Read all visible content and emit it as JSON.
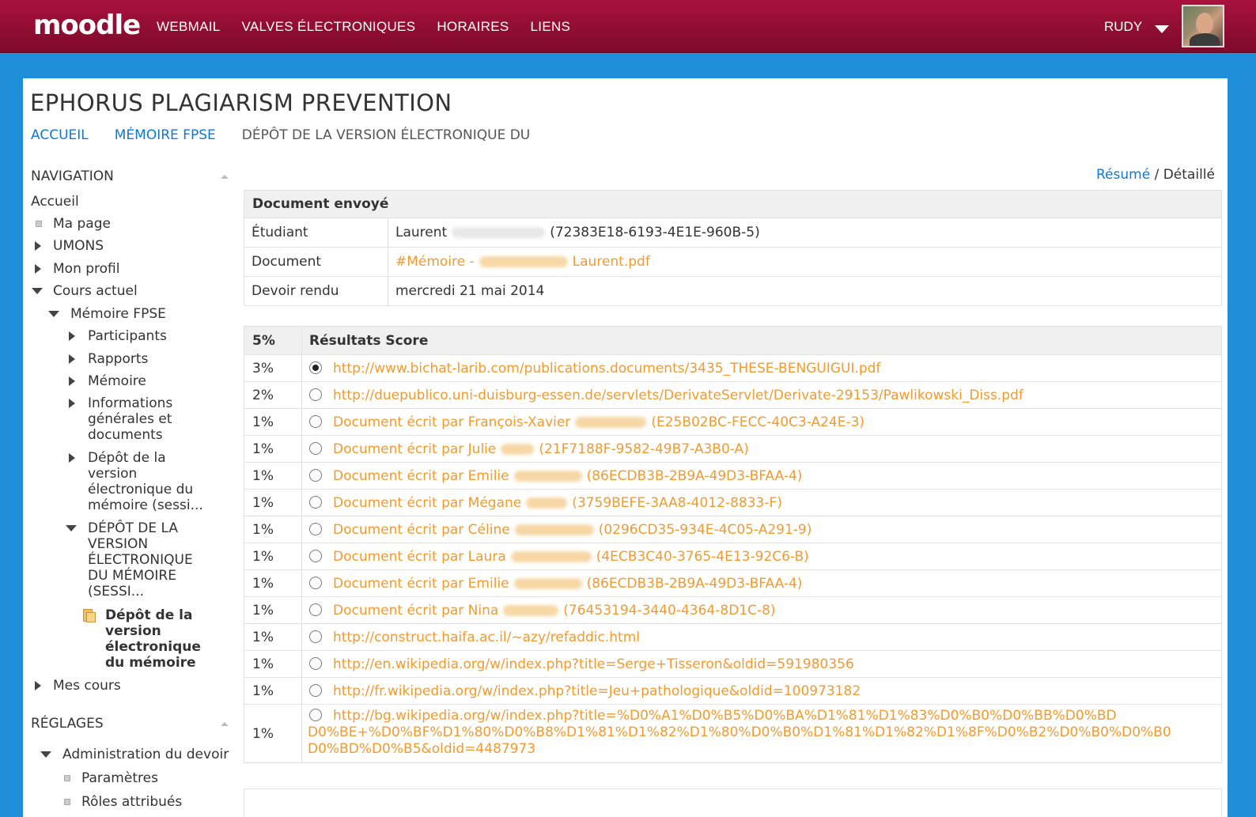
{
  "header": {
    "logo": "moodle",
    "nav": [
      "WEBMAIL",
      "VALVES ÉLECTRONIQUES",
      "HORAIRES",
      "LIENS"
    ],
    "user": "RUDY"
  },
  "page": {
    "title": "EPHORUS PLAGIARISM PREVENTION",
    "breadcrumb": [
      "ACCUEIL",
      "MÉMOIRE FPSE",
      "DÉPÔT DE LA VERSION ÉLECTRONIQUE DU"
    ]
  },
  "sidebar": {
    "navigation_title": "NAVIGATION",
    "items": {
      "accueil": "Accueil",
      "ma_page": "Ma page",
      "umons": "UMONS",
      "mon_profil": "Mon profil",
      "cours_actuel": "Cours actuel",
      "memoire_fpse": "Mémoire FPSE",
      "participants": "Participants",
      "rapports": "Rapports",
      "memoire": "Mémoire",
      "informations": [
        "Informations",
        "générales et",
        "documents"
      ],
      "depot": [
        "Dépôt de la",
        "version",
        "électronique du",
        "mémoire (sessi..."
      ],
      "depot_caps": [
        "DÉPÔT DE LA",
        "VERSION",
        "ÉLECTRONIQUE",
        "DU MÉMOIRE",
        "(SESSI..."
      ],
      "depot_current": [
        "Dépôt de la",
        "version",
        "électronique",
        "du mémoire"
      ],
      "mes_cours": "Mes cours"
    },
    "settings_title": "RÉGLAGES",
    "settings": {
      "admin": "Administration du devoir",
      "parametres": "Paramètres",
      "roles": "Rôles attribués"
    }
  },
  "view_toggle": {
    "summary": "Résumé",
    "separator": "/",
    "detailed": "Détaillé"
  },
  "document": {
    "header": "Document envoyé",
    "student_label": "Étudiant",
    "student_name": "Laurent",
    "student_id": "(72383E18-6193-4E1E-960B-5)",
    "document_label": "Document",
    "document_prefix": "#Mémoire -",
    "document_suffix": "Laurent.pdf",
    "submitted_label": "Devoir rendu",
    "submitted_value": "mercredi 21 mai 2014"
  },
  "results": {
    "total": "5%",
    "header": "Résultats Score",
    "rows": [
      {
        "pct": "3%",
        "selected": true,
        "text": "http://www.bichat-larib.com/publications.documents/3435_THESE-BENGUIGUI.pdf",
        "tail": ""
      },
      {
        "pct": "2%",
        "selected": false,
        "text": "http://duepublico.uni-duisburg-essen.de/servlets/DerivateServlet/Derivate-29153/Pawlikowski_Diss.pdf",
        "tail": ""
      },
      {
        "pct": "1%",
        "selected": false,
        "text": "Document écrit par François-Xavier",
        "tail": "(E25B02BC-FECC-40C3-A24E-3)"
      },
      {
        "pct": "1%",
        "selected": false,
        "text": "Document écrit par Julie",
        "tail": "(21F7188F-9582-49B7-A3B0-A)"
      },
      {
        "pct": "1%",
        "selected": false,
        "text": "Document écrit par Emilie",
        "tail": "(86ECDB3B-2B9A-49D3-BFAA-4)"
      },
      {
        "pct": "1%",
        "selected": false,
        "text": "Document écrit par Mégane",
        "tail": "(3759BEFE-3AA8-4012-8833-F)"
      },
      {
        "pct": "1%",
        "selected": false,
        "text": "Document écrit par Céline",
        "tail": "(0296CD35-934E-4C05-A291-9)"
      },
      {
        "pct": "1%",
        "selected": false,
        "text": "Document écrit par Laura",
        "tail": "(4ECB3C40-3765-4E13-92C6-B)"
      },
      {
        "pct": "1%",
        "selected": false,
        "text": "Document écrit par Emilie",
        "tail": "(86ECDB3B-2B9A-49D3-BFAA-4)"
      },
      {
        "pct": "1%",
        "selected": false,
        "text": "Document écrit par Nina",
        "tail": "(76453194-3440-4364-8D1C-8)"
      },
      {
        "pct": "1%",
        "selected": false,
        "text": "http://construct.haifa.ac.il/~azy/refaddic.html",
        "tail": ""
      },
      {
        "pct": "1%",
        "selected": false,
        "text": "http://en.wikipedia.org/w/index.php?title=Serge+Tisseron&oldid=591980356",
        "tail": ""
      },
      {
        "pct": "1%",
        "selected": false,
        "text": "http://fr.wikipedia.org/w/index.php?title=Jeu+pathologique&oldid=100973182",
        "tail": ""
      }
    ],
    "long_row": {
      "pct": "1%",
      "line1": "http://bg.wikipedia.org/w/index.php?title=%D0%A1%D0%B5%D0%BA%D1%81%D1%83%D0%B0%D0%BB%D0%BD",
      "line2": "D0%BE+%D0%BF%D1%80%D0%B8%D1%81%D1%82%D1%80%D0%B0%D1%81%D1%82%D1%8F%D0%B2%D0%B0%D0%B0",
      "line3": "D0%BD%D0%B5&oldid=4487973"
    }
  },
  "colors": {
    "topbar": "#8f0e33",
    "background": "#1e8fd8",
    "link": "#1177d1",
    "result_link": "#f29a2e"
  }
}
